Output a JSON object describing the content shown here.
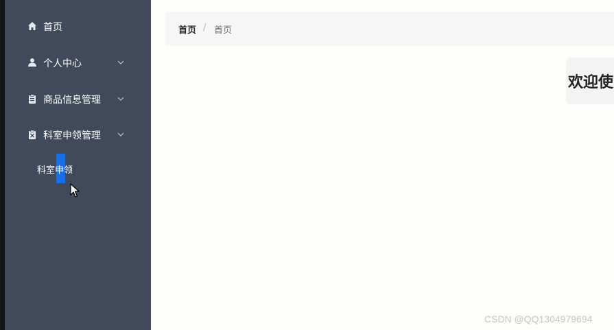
{
  "sidebar": {
    "items": [
      {
        "label": "首页",
        "icon": "home-icon"
      },
      {
        "label": "个人中心",
        "icon": "user-icon"
      },
      {
        "label": "商品信息管理",
        "icon": "clipboard-icon"
      },
      {
        "label": "科室申领管理",
        "icon": "clipboard-x-icon"
      }
    ],
    "sub_items": [
      {
        "label": "科室申领"
      }
    ]
  },
  "breadcrumb": {
    "home": "首页",
    "separator": "/",
    "current": "首页"
  },
  "main": {
    "welcome": "欢迎使"
  },
  "watermark": "CSDN @QQ1304979694",
  "colors": {
    "sidebar_bg": "#404a5a",
    "selection_accent": "#1670ea",
    "breadcrumb_bg": "#f6f6f6"
  }
}
